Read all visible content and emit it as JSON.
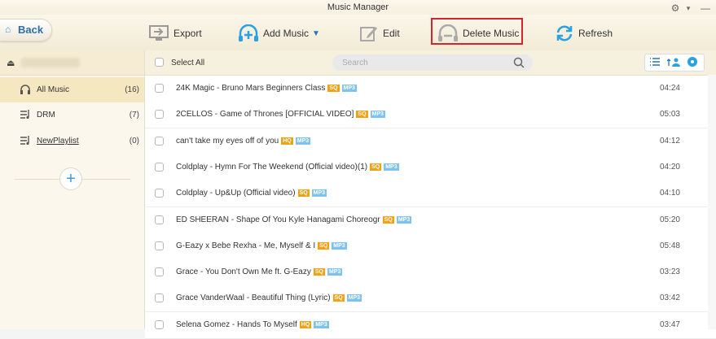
{
  "window": {
    "title": "Music Manager"
  },
  "toolbar": {
    "back_label": "Back",
    "export_label": "Export",
    "add_music_label": "Add Music",
    "edit_label": "Edit",
    "delete_music_label": "Delete Music",
    "refresh_label": "Refresh"
  },
  "sidebar": {
    "items": [
      {
        "label": "All Music",
        "count": "(16)"
      },
      {
        "label": "DRM",
        "count": "(7)"
      },
      {
        "label": "NewPlaylist",
        "count": "(0)"
      }
    ]
  },
  "list": {
    "select_all_label": "Select All",
    "search_placeholder": "Search",
    "rows": [
      {
        "title": "24K Magic - Bruno Mars   Beginners Class",
        "quality": "SQ",
        "format": "MP3",
        "duration": "04:24"
      },
      {
        "title": "2CELLOS - Game of Thrones [OFFICIAL VIDEO]",
        "quality": "SQ",
        "format": "MP3",
        "duration": "05:03"
      },
      {
        "title": "can't take my eyes off of you",
        "quality": "HQ",
        "format": "MP3",
        "duration": "04:12"
      },
      {
        "title": "Coldplay - Hymn For The Weekend (Official video)(1)",
        "quality": "SQ",
        "format": "MP3",
        "duration": "04:20"
      },
      {
        "title": "Coldplay - Up&Up (Official video)",
        "quality": "SQ",
        "format": "MP3",
        "duration": "04:10"
      },
      {
        "title": "ED SHEERAN - Shape Of You   Kyle Hanagami Choreogr",
        "quality": "SQ",
        "format": "MP3",
        "duration": "05:20"
      },
      {
        "title": "G-Eazy x Bebe Rexha - Me, Myself & I",
        "quality": "SQ",
        "format": "MP3",
        "duration": "05:48"
      },
      {
        "title": "Grace - You Don't Own Me ft. G-Eazy",
        "quality": "SQ",
        "format": "MP3",
        "duration": "03:23"
      },
      {
        "title": "Grace VanderWaal - Beautiful Thing (Lyric)",
        "quality": "SQ",
        "format": "MP3",
        "duration": "03:42"
      },
      {
        "title": "Selena Gomez - Hands To Myself",
        "quality": "HQ",
        "format": "MP3",
        "duration": "03:47"
      }
    ]
  },
  "colors": {
    "accent": "#3a9bd8",
    "highlight_box": "#d8232a",
    "quality_tag": "#f1a114",
    "format_tag": "#7ec3ef"
  }
}
